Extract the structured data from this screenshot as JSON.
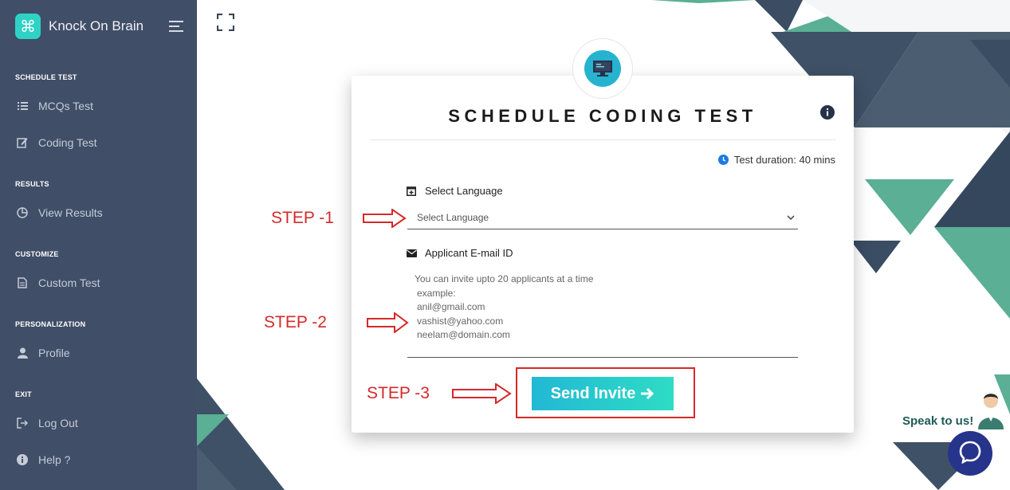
{
  "sidebar": {
    "brand": "Knock On Brain",
    "sections": [
      {
        "title": "SCHEDULE TEST",
        "items": [
          {
            "label": "MCQs Test",
            "icon": "list-icon"
          },
          {
            "label": "Coding Test",
            "icon": "edit-icon"
          }
        ]
      },
      {
        "title": "RESULTS",
        "items": [
          {
            "label": "View Results",
            "icon": "pie-chart-icon"
          }
        ]
      },
      {
        "title": "CUSTOMIZE",
        "items": [
          {
            "label": "Custom Test",
            "icon": "file-icon"
          }
        ]
      },
      {
        "title": "PERSONALIZATION",
        "items": [
          {
            "label": "Profile",
            "icon": "user-icon"
          }
        ]
      },
      {
        "title": "EXIT",
        "items": [
          {
            "label": "Log Out",
            "icon": "logout-icon"
          },
          {
            "label": "Help ?",
            "icon": "info-circle-icon"
          }
        ]
      }
    ]
  },
  "card": {
    "title": "SCHEDULE CODING TEST",
    "duration": "Test duration: 40 mins",
    "language_label": "Select Language",
    "language_placeholder": "Select Language",
    "email_label": "Applicant E-mail ID",
    "email_placeholder_lines": [
      "You can invite upto 20 applicants at a time",
      "example:",
      "anil@gmail.com",
      "vashist@yahoo.com",
      "neelam@domain.com"
    ],
    "send_label": "Send Invite"
  },
  "annotations": {
    "step1": "STEP -1",
    "step2": "STEP -2",
    "step3": "STEP -3"
  },
  "chat": {
    "label": "Speak to us!"
  },
  "colors": {
    "sidebar": "#404e67",
    "accent": "#2ed3c6",
    "annotation_red": "#d42a2a",
    "chat": "#27348b"
  }
}
